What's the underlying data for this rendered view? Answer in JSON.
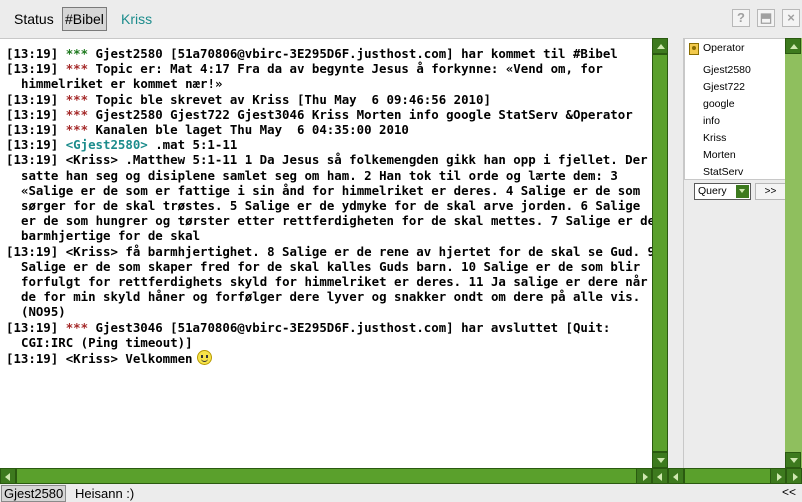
{
  "tabs": {
    "status": "Status",
    "bibel": "#Bibel",
    "kriss": "Kriss"
  },
  "window_buttons": {
    "help": "?",
    "float": "⬒",
    "close": "×"
  },
  "chat": {
    "lines": [
      {
        "ts": "[13:19]",
        "marker": "***",
        "marker_type": "join",
        "text": "Gjest2580 [51a70806@vbirc-3E295D6F.justhost.com] har kommet til #Bibel"
      },
      {
        "ts": "[13:19]",
        "marker": "***",
        "marker_type": "info",
        "text": "Topic er: Mat 4:17 Fra da av begynte Jesus å forkynne: «Vend om, for himmelriket er kommet nær!»"
      },
      {
        "ts": "[13:19]",
        "marker": "***",
        "marker_type": "info",
        "text": "Topic ble skrevet av Kriss [Thu May  6 09:46:56 2010]"
      },
      {
        "ts": "[13:19]",
        "marker": "***",
        "marker_type": "info",
        "text": "Gjest2580 Gjest722 Gjest3046 Kriss Morten info google StatServ &Operator"
      },
      {
        "ts": "[13:19]",
        "marker": "***",
        "marker_type": "info",
        "text": "Kanalen ble laget Thu May  6 04:35:00 2010"
      },
      {
        "ts": "[13:19]",
        "marker": "",
        "marker_type": "own",
        "nick": "<Gjest2580>",
        "text": ".mat 5:1-11"
      },
      {
        "ts": "[13:19]",
        "marker": "",
        "marker_type": "msg",
        "nick": "<Kriss>",
        "text": ".Matthew 5:1-11 1 Da Jesus så folkemengden gikk han opp i fjellet. Der satte han seg og disiplene samlet seg om ham. 2 Han tok til orde og lærte dem: 3 «Salige er de som er fattige i sin ånd for himmelriket er deres. 4 Salige er de som sørger for de skal trøstes. 5 Salige er de ydmyke for de skal arve jorden. 6 Salige er de som hungrer og tørster etter rettferdigheten for de skal mettes. 7 Salige er de barmhjertige for de skal"
      },
      {
        "ts": "[13:19]",
        "marker": "",
        "marker_type": "msg",
        "nick": "<Kriss>",
        "text": "få barmhjertighet. 8 Salige er de rene av hjertet for de skal se Gud. 9 Salige er de som skaper fred for de skal kalles Guds barn. 10 Salige er de som blir forfulgt for rettferdighets skyld for himmelriket er deres. 11 Ja salige er dere når de for min skyld håner og forfølger dere lyver og snakker ondt om dere på alle vis. (NO95)"
      },
      {
        "ts": "[13:19]",
        "marker": "***",
        "marker_type": "info",
        "text": "Gjest3046 [51a70806@vbirc-3E295D6F.justhost.com] har avsluttet [Quit: CGI:IRC (Ping timeout)]"
      },
      {
        "ts": "[13:19]",
        "marker": "",
        "marker_type": "msg",
        "nick": "<Kriss>",
        "text": "Velkommen",
        "smiley": "smiley-icon"
      }
    ]
  },
  "users": {
    "operator_icon": "operator-icon",
    "items": [
      "Operator",
      "Gjest2580",
      "Gjest722",
      "google",
      "info",
      "Kriss",
      "Morten",
      "StatServ"
    ]
  },
  "query": {
    "selected": "Query",
    "go_label": ">>"
  },
  "input": {
    "nick": "Gjest2580",
    "value": "Heisann :)",
    "collapse_label": "<<"
  },
  "colors": {
    "scrollbar": "#8fbf5e",
    "scroll_button": "#3d7a1e",
    "own_nick": "#1c8c8c",
    "info_marker": "#a52a2a",
    "join_marker": "#1f7a1f"
  }
}
